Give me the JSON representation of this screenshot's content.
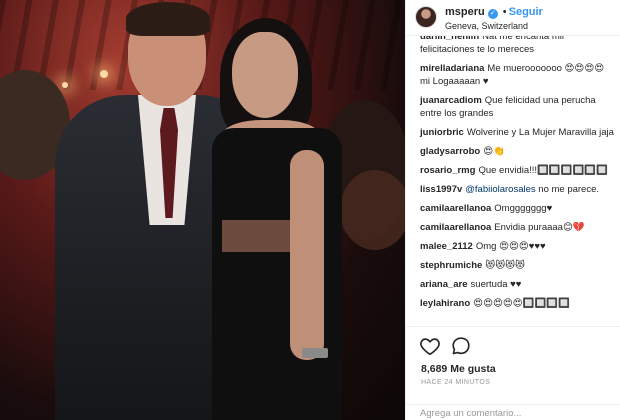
{
  "post": {
    "username": "msperu",
    "follow_label": "Seguir",
    "location": "Geneva, Switzerland"
  },
  "comments": [
    {
      "user": "darlin_heniin",
      "text": "Nat me encanta mil felicitaciones te lo mereces"
    },
    {
      "user": "mirelladariana",
      "text": "Me muerooooooo 😍😍😍😍 mi Logaaaaan ♥"
    },
    {
      "user": "juanarcadiom",
      "text": "Que felicidad una perucha entre los grandes"
    },
    {
      "user": "juniorbric",
      "text": "Wolverine y La Mujer Maravilla jaja"
    },
    {
      "user": "gladysarrobo",
      "text": "😍👏"
    },
    {
      "user": "rosario_rmg",
      "text": "Que envidia!!!🔲🔲🔲🔲🔲🔲"
    },
    {
      "user": "liss1997v",
      "mention": "@fabiiolarosales",
      "text": "no me parece."
    },
    {
      "user": "camilaarellanoa",
      "text": "Omggggggg♥"
    },
    {
      "user": "camilaarellanoa",
      "text": "Envidia puraaaa😊💔"
    },
    {
      "user": "malee_2112",
      "text": "Omg 😍😍😍♥♥♥"
    },
    {
      "user": "stephrumiche",
      "text": "😻😻😻😻"
    },
    {
      "user": "ariana_are",
      "text": "suertuda ♥♥"
    },
    {
      "user": "leylahirano",
      "text": "😍😍😍😍😍🔲🔲🔲🔲"
    }
  ],
  "actions": {
    "like_icon": "heart-outline-icon",
    "comment_icon": "speech-bubble-icon",
    "likes": "8,689 Me gusta",
    "time_ago": "HACE 24 MINUTOS"
  },
  "add_comment": {
    "placeholder": "Agrega un comentario..."
  },
  "colors": {
    "link_blue": "#3897f0",
    "verified_blue": "#3897f0",
    "text": "#262626",
    "muted": "#999999"
  }
}
